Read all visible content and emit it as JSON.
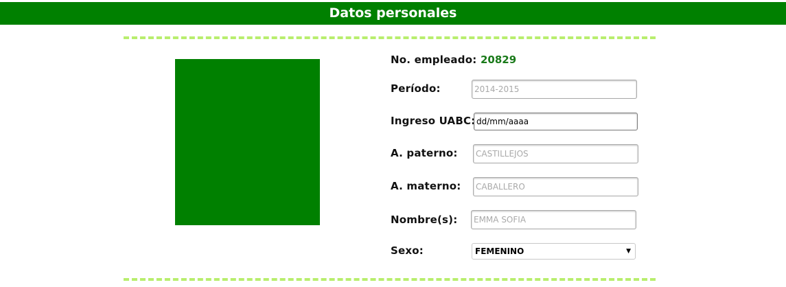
{
  "header": {
    "title": "Datos personales"
  },
  "form": {
    "employee_number_label": "No. empleado:",
    "employee_number_value": "20829",
    "period_label": "Período:",
    "period_value": "2014-2015",
    "ingreso_label": "Ingreso UABC:",
    "ingreso_placeholder": "dd/mm/aaaa",
    "paterno_label": "A. paterno:",
    "paterno_value": "CASTILLEJOS",
    "materno_label": "A. materno:",
    "materno_value": "CABALLERO",
    "nombre_label": "Nombre(s):",
    "nombre_value": "EMMA SOFIA",
    "sexo_label": "Sexo:",
    "sexo_value": "FEMENINO",
    "sexo_arrow": "▼"
  },
  "colors": {
    "header_bg": "#008000",
    "photo_bg": "#008000",
    "divider": "#b8ee6e",
    "employee_number": "#1a7a1a"
  }
}
